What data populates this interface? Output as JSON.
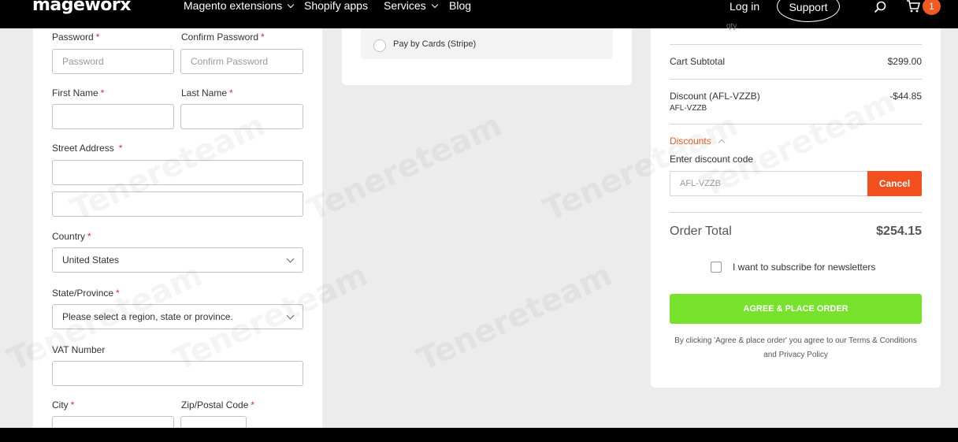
{
  "nav": {
    "logo": "mageworx",
    "items": [
      {
        "label": "Magento extensions",
        "dropdown": true
      },
      {
        "label": "Shopify apps",
        "dropdown": false
      },
      {
        "label": "Services",
        "dropdown": true
      },
      {
        "label": "Blog",
        "dropdown": false
      }
    ],
    "login": "Log in",
    "support": "Support",
    "cart_count": "1",
    "search_icon": "search-icon",
    "cart_icon": "cart-icon"
  },
  "form": {
    "password_label": "Password",
    "password_placeholder": "Password",
    "confirm_label": "Confirm Password",
    "confirm_placeholder": "Confirm Password",
    "first_name_label": "First Name",
    "last_name_label": "Last Name",
    "street_label": "Street Address",
    "country_label": "Country",
    "country_value": "United States",
    "state_label": "State/Province",
    "state_value": "Please select a region, state or province.",
    "vat_label": "VAT Number",
    "city_label": "City",
    "zip_label": "Zip/Postal Code",
    "required_mark": "*"
  },
  "payment": {
    "option_label": "Pay by Cards (Stripe)"
  },
  "summary": {
    "qty_label": "qty.",
    "subtotal_label": "Cart Subtotal",
    "subtotal_value": "$299.00",
    "discount_label": "Discount (AFL-VZZB)",
    "discount_code_small": "AFL-VZZB",
    "discount_value": "-$44.85",
    "discounts_toggle": "Discounts",
    "enter_code_label": "Enter discount code",
    "code_value": "AFL-VZZB",
    "cancel_label": "Cancel",
    "order_total_label": "Order Total",
    "order_total_value": "$254.15",
    "newsletter_label": "I want to subscribe for newsletters",
    "place_order_label": "AGREE & PLACE ORDER",
    "terms_text": "By clicking 'Agree & place order' you agree to our Terms & Conditions and Privacy Policy"
  },
  "colors": {
    "accent": "#f15a22",
    "place_order": "#76e22c",
    "required": "#e02b27"
  },
  "watermark": "Tenereteam"
}
